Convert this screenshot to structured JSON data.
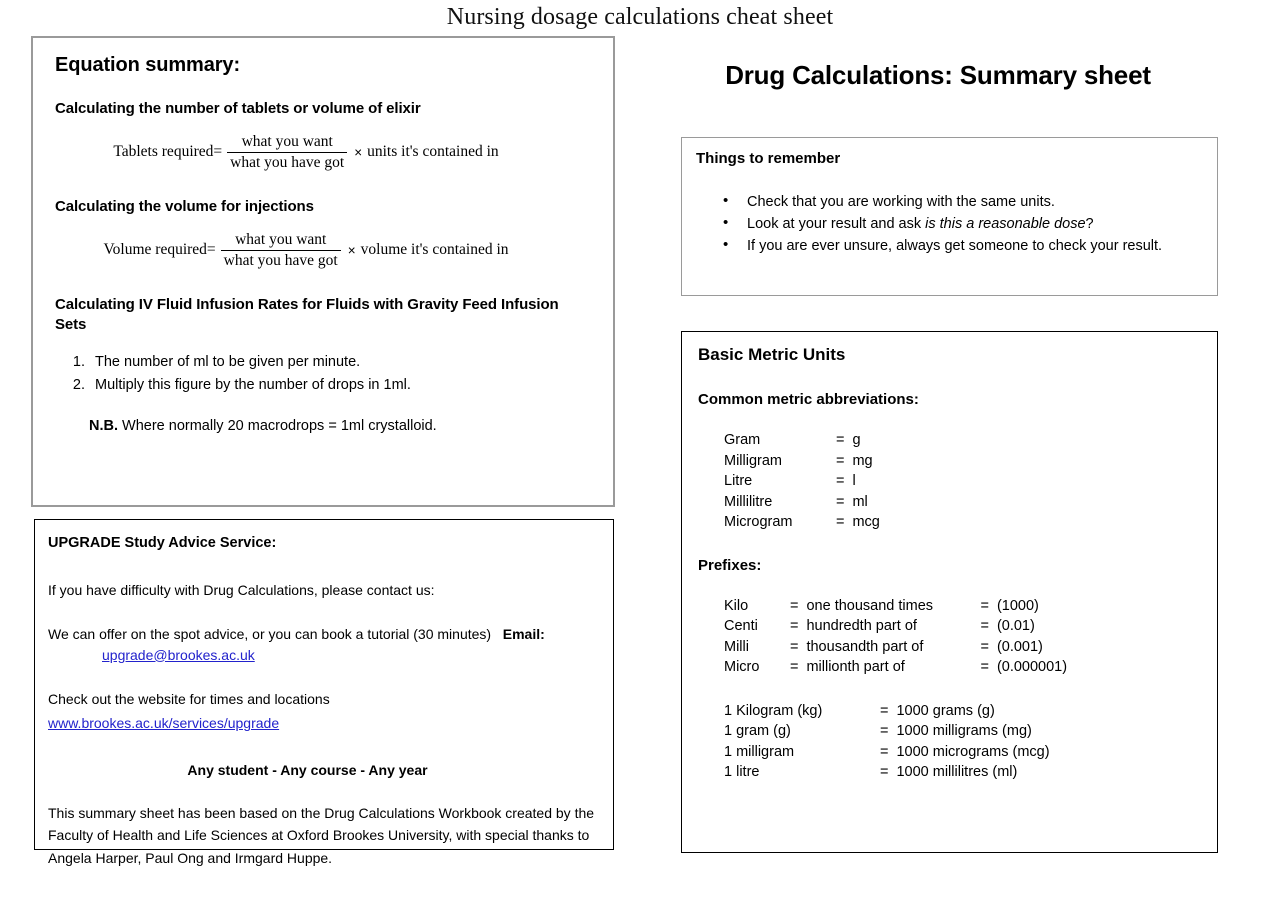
{
  "document": {
    "title": "Nursing dosage calculations cheat sheet"
  },
  "equation_box": {
    "heading": "Equation summary:",
    "section1_heading": "Calculating the number of tablets or volume of elixir",
    "formula1": {
      "lead": "Tablets required=",
      "numerator": "what you want",
      "denominator": "what you have got",
      "operator": "×",
      "tail": "units it's contained in"
    },
    "section2_heading": "Calculating the volume for injections",
    "formula2": {
      "lead": "Volume required=",
      "numerator": "what you want",
      "denominator": "what you have got",
      "operator": "×",
      "tail": "volume it's contained in"
    },
    "section3_heading": "Calculating IV Fluid Infusion Rates for Fluids with Gravity Feed Infusion Sets",
    "steps": [
      "The number of ml to be given per minute.",
      "Multiply this figure by the number of drops in 1ml."
    ],
    "nb_label": "N.B.",
    "nb_text": "Where normally 20 macrodrops = 1ml crystalloid."
  },
  "upgrade_box": {
    "title": "UPGRADE Study Advice Service:",
    "line1": "If you have difficulty with Drug Calculations, please contact us:",
    "line2": "We can offer on the spot advice, or you can book a tutorial (30 minutes)",
    "email_label": "Email:",
    "email": "upgrade@brookes.ac.uk",
    "line3": "Check out the website for times and locations",
    "website": "www.brookes.ac.uk/services/upgrade",
    "tagline": "Any student - Any course - Any year",
    "footer": "This summary sheet has been based on the Drug Calculations Workbook created by the Faculty of Health and Life Sciences at Oxford Brookes University, with special thanks to Angela Harper, Paul Ong and Irmgard Huppe."
  },
  "summary": {
    "title": "Drug Calculations: Summary sheet"
  },
  "remember_box": {
    "title": "Things to remember",
    "bullets": [
      {
        "before": "Check that you are working with the same units.",
        "italic": "",
        "after": ""
      },
      {
        "before": "Look at your result and ask ",
        "italic": "is this a reasonable dose",
        "after": "?"
      },
      {
        "before": "If you are ever unsure, always get someone to check your result.",
        "italic": "",
        "after": ""
      }
    ]
  },
  "metric_box": {
    "title": "Basic Metric Units",
    "abbrev_heading": "Common metric abbreviations:",
    "abbreviations": [
      {
        "name": "Gram",
        "eq": "=",
        "value": "g"
      },
      {
        "name": "Milligram",
        "eq": "=",
        "value": "mg"
      },
      {
        "name": "Litre",
        "eq": "=",
        "value": "l"
      },
      {
        "name": "Millilitre",
        "eq": "=",
        "value": "ml"
      },
      {
        "name": "Microgram",
        "eq": "=",
        "value": "mcg"
      }
    ],
    "prefix_heading": "Prefixes:",
    "prefixes": [
      {
        "name": "Kilo",
        "eq1": "=",
        "meaning": "one thousand times",
        "eq2": "=",
        "value": "(1000)"
      },
      {
        "name": "Centi",
        "eq1": "=",
        "meaning": "hundredth part of",
        "eq2": "=",
        "value": "(0.01)"
      },
      {
        "name": "Milli",
        "eq1": "=",
        "meaning": "thousandth part of",
        "eq2": "=",
        "value": "(0.001)"
      },
      {
        "name": "Micro",
        "eq1": "=",
        "meaning": "millionth part of",
        "eq2": "=",
        "value": "(0.000001)"
      }
    ],
    "conversions": [
      {
        "from": "1 Kilogram (kg)",
        "eq": "=",
        "to": "1000 grams (g)"
      },
      {
        "from": "1 gram (g)",
        "eq": "=",
        "to": "1000 milligrams (mg)"
      },
      {
        "from": "1 milligram",
        "eq": "=",
        "to": "1000 micrograms (mcg)"
      },
      {
        "from": "1 litre",
        "eq": "=",
        "to": "1000 millilitres (ml)"
      }
    ]
  }
}
